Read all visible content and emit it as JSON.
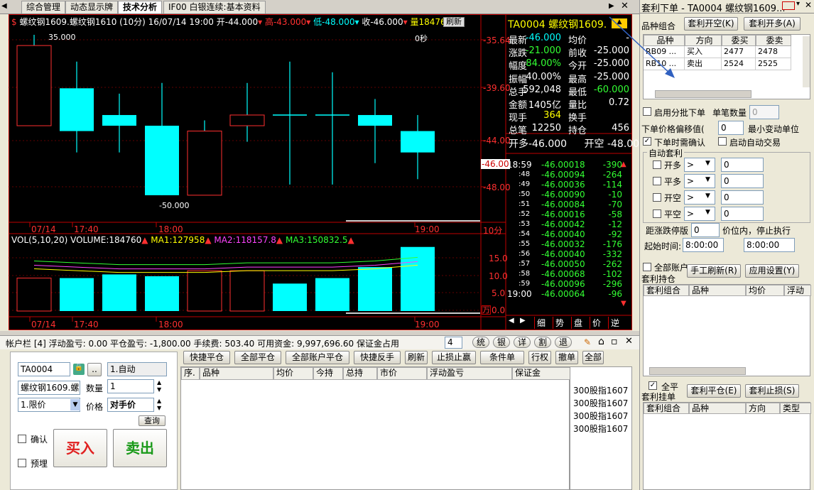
{
  "tabs": [
    "综合管理",
    "动态显示牌",
    "技术分析",
    "IF00 白银连续:基本资料"
  ],
  "chart_header": {
    "symbol": "螺纹钢1609.螺纹钢1610 (10分)",
    "date": "16/07/14 19:00",
    "open": "开-44.000",
    "high": "高-43.000",
    "low": "低-48.000",
    "close": "收-46.000",
    "vol": "量184760",
    "refresh": "刷新",
    "countdown": "0秒"
  },
  "price_axis": [
    "-35.64",
    "-39.60",
    "-44.00",
    "-46.00",
    "-48.00"
  ],
  "candle_labels": {
    "hi": "35.000",
    "lo": "-50.000"
  },
  "time_axis": [
    "07/14",
    "17:40",
    "18:00",
    "19:00"
  ],
  "period_label": "10分",
  "volume_header": {
    "vol": "VOL(5,10,20) VOLUME:184760",
    "ma1": "MA1:127958",
    "ma2": "MA2:118157.8",
    "ma3": "MA3:150832.5"
  },
  "vol_axis": [
    "15.0",
    "10.0",
    "5.0",
    "0.0"
  ],
  "vol_unit": "万",
  "chart_data": {
    "type": "candlestick",
    "x": [
      "1",
      "2",
      "3",
      "4",
      "5",
      "6",
      "7",
      "8",
      "9",
      "10"
    ],
    "open": [
      -36.0,
      -40.0,
      -42.5,
      -43.5,
      -44.0,
      -42.5,
      -42.5,
      -42.5,
      -42.5,
      -44.0
    ],
    "close": [
      -43.5,
      -44.0,
      -43.5,
      -50.0,
      -50.0,
      -43.5,
      -42.5,
      -42.5,
      -43.5,
      -46.0
    ],
    "high": [
      -35.0,
      -37.5,
      -40.5,
      -39.5,
      -43.0,
      -39.5,
      -37.5,
      -38.5,
      -41.0,
      -42.5
    ],
    "low": [
      -43.5,
      -46.0,
      -46.0,
      -50.0,
      -50.0,
      -45.0,
      -49.0,
      -49.0,
      -47.0,
      -48.5
    ],
    "volume": [
      9.0,
      9.0,
      10.0,
      9.5,
      11.0,
      11.0,
      7.5,
      9.0,
      12.0,
      17.5
    ],
    "ma_vol": [
      12.5,
      12.0,
      11.5,
      11.5,
      11.5,
      12.0,
      12.0,
      12.0,
      12.5,
      13.5
    ],
    "ylim": [
      -52,
      -34
    ],
    "vol_ylim": [
      0,
      19
    ]
  },
  "quote": {
    "code": "TA0004",
    "name": "螺纹钢1609.",
    "rows": [
      [
        "最新",
        "-46.000",
        "均价",
        "-"
      ],
      [
        "涨跌",
        "-21.000",
        "前收",
        "-25.000"
      ],
      [
        "幅度",
        "84.00%",
        "今开",
        "-25.000"
      ],
      [
        "振幅",
        "40.00%",
        "最高",
        "-25.000"
      ],
      [
        "总手",
        "592,048",
        "最低",
        "-60.000"
      ],
      [
        "金额",
        "1405亿",
        "量比",
        "0.72"
      ],
      [
        "现手",
        "364",
        "换手",
        ""
      ],
      [
        "总笔",
        "12250",
        "持仓",
        "456"
      ]
    ],
    "open_long": "开多-46.000",
    "open_short": "开空 -48.000"
  },
  "ticks": [
    [
      "18:59",
      "-46.00018",
      "-390"
    ],
    [
      ":48",
      "-46.00094",
      "-264"
    ],
    [
      ":49",
      "-46.00036",
      "-114"
    ],
    [
      ":50",
      "-46.00090",
      "-10"
    ],
    [
      ":51",
      "-46.00084",
      "-70"
    ],
    [
      ":52",
      "-46.00016",
      "-58"
    ],
    [
      ":53",
      "-46.00042",
      "-12"
    ],
    [
      ":54",
      "-46.00040",
      "-92"
    ],
    [
      ":55",
      "-46.00032",
      "-176"
    ],
    [
      ":56",
      "-46.00040",
      "-332"
    ],
    [
      ":57",
      "-46.00050",
      "-262"
    ],
    [
      ":58",
      "-46.00068",
      "-102"
    ],
    [
      ":59",
      "-46.00096",
      "-296"
    ],
    [
      "19:00",
      "-46.00064",
      "-96"
    ]
  ],
  "tick_tabs": [
    "细",
    "势",
    "盘",
    "价",
    "逆"
  ],
  "arbitrage": {
    "title": "套利下单  - TA0004 螺纹钢1609...",
    "combo_label": "品种组合",
    "btn_open_short": "套利开空(K)",
    "btn_open_long": "套利开多(A)",
    "table_headers": [
      "品种",
      "方向",
      "委买",
      "委卖"
    ],
    "table_rows": [
      [
        "RB09 ...",
        "买入",
        "2477",
        "2478"
      ],
      [
        "RB10 ...",
        "卖出",
        "2524",
        "2525"
      ]
    ],
    "batch_label": "启用分批下单",
    "single_qty_label": "单笔数量",
    "single_qty": "0",
    "offset_label": "下单价格偏移值(",
    "offset_value": "0",
    "min_unit_label": "最小变动单位",
    "confirm_label": "下单时需确认",
    "auto_trade_label": "启动自动交易",
    "auto_section": "自动套利",
    "auto_rows": [
      [
        "开多",
        ">",
        "0"
      ],
      [
        "平多",
        ">",
        "0"
      ],
      [
        "开空",
        ">",
        "0"
      ],
      [
        "平空",
        ">",
        "0"
      ]
    ],
    "stop_label": "距涨跌停版",
    "stop_value": "0",
    "stop_suffix": "价位内，停止执行",
    "start_time_label": "起始时间:",
    "start_time": "8:00:00",
    "end_time": "8:00:00",
    "all_accounts_label": "全部账户",
    "manual_refresh": "手工刷新(R)",
    "apply_settings": "应用设置(Y)",
    "holdings_title": "套利持仓",
    "holdings_headers": [
      "套利组合",
      "品种",
      "均价",
      "浮动"
    ],
    "all_close_label": "全平",
    "pending_title": "套利挂单",
    "btn_close": "套利平仓(E)",
    "btn_stop": "套利止损(S)",
    "pending_headers": [
      "套利组合",
      "品种",
      "方向",
      "类型"
    ]
  },
  "account": {
    "summary": "帐户栏 [4]  浮动盈亏: 0.00    平仓盈亏: -1,800.00    手续费: 503.40    可用资金: 9,997,696.60    保证金占用",
    "dropdown": "4",
    "mini_buttons": [
      "统",
      "银",
      "详",
      "割",
      "退"
    ],
    "action_buttons": [
      "快捷平仓",
      "全部平仓",
      "全部账户平仓",
      "快捷反手",
      "刷新",
      "止损止赢",
      "条件单",
      "行权",
      "撤单",
      "全部"
    ],
    "pos_headers": [
      "序.",
      "品种",
      "均价",
      "今持",
      "总持",
      "市价",
      "浮动盈亏",
      "保证金"
    ],
    "instruments": [
      "300股指1607",
      "300股指1607",
      "300股指1607",
      "300股指1607"
    ]
  },
  "order": {
    "account": "TA0004",
    "mode": "1.自动",
    "contract": "螺纹钢1609.螺",
    "qty_label": "数量",
    "qty": "1",
    "price_type": "1.限价",
    "price_label": "价格",
    "price": "对手价",
    "query": "查询",
    "confirm": "确认",
    "preorder": "预埋",
    "buy": "买入",
    "sell": "卖出"
  }
}
